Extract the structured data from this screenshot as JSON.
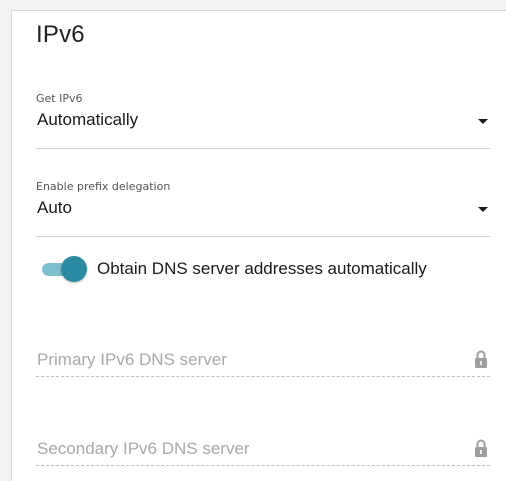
{
  "section": {
    "title": "IPv6"
  },
  "get_ipv6": {
    "label": "Get IPv6",
    "value": "Automatically"
  },
  "prefix_delegation": {
    "label": "Enable prefix delegation",
    "value": "Auto"
  },
  "dns_toggle": {
    "label": "Obtain DNS server addresses automatically",
    "enabled": true
  },
  "primary_dns": {
    "placeholder": "Primary IPv6 DNS server",
    "icon": "lock-icon",
    "disabled": true
  },
  "secondary_dns": {
    "placeholder": "Secondary IPv6 DNS server",
    "icon": "lock-icon",
    "disabled": true
  },
  "colors": {
    "accent": "#2d8aa3",
    "accent_track": "#7fbfcf",
    "placeholder": "#a8a8a8"
  }
}
